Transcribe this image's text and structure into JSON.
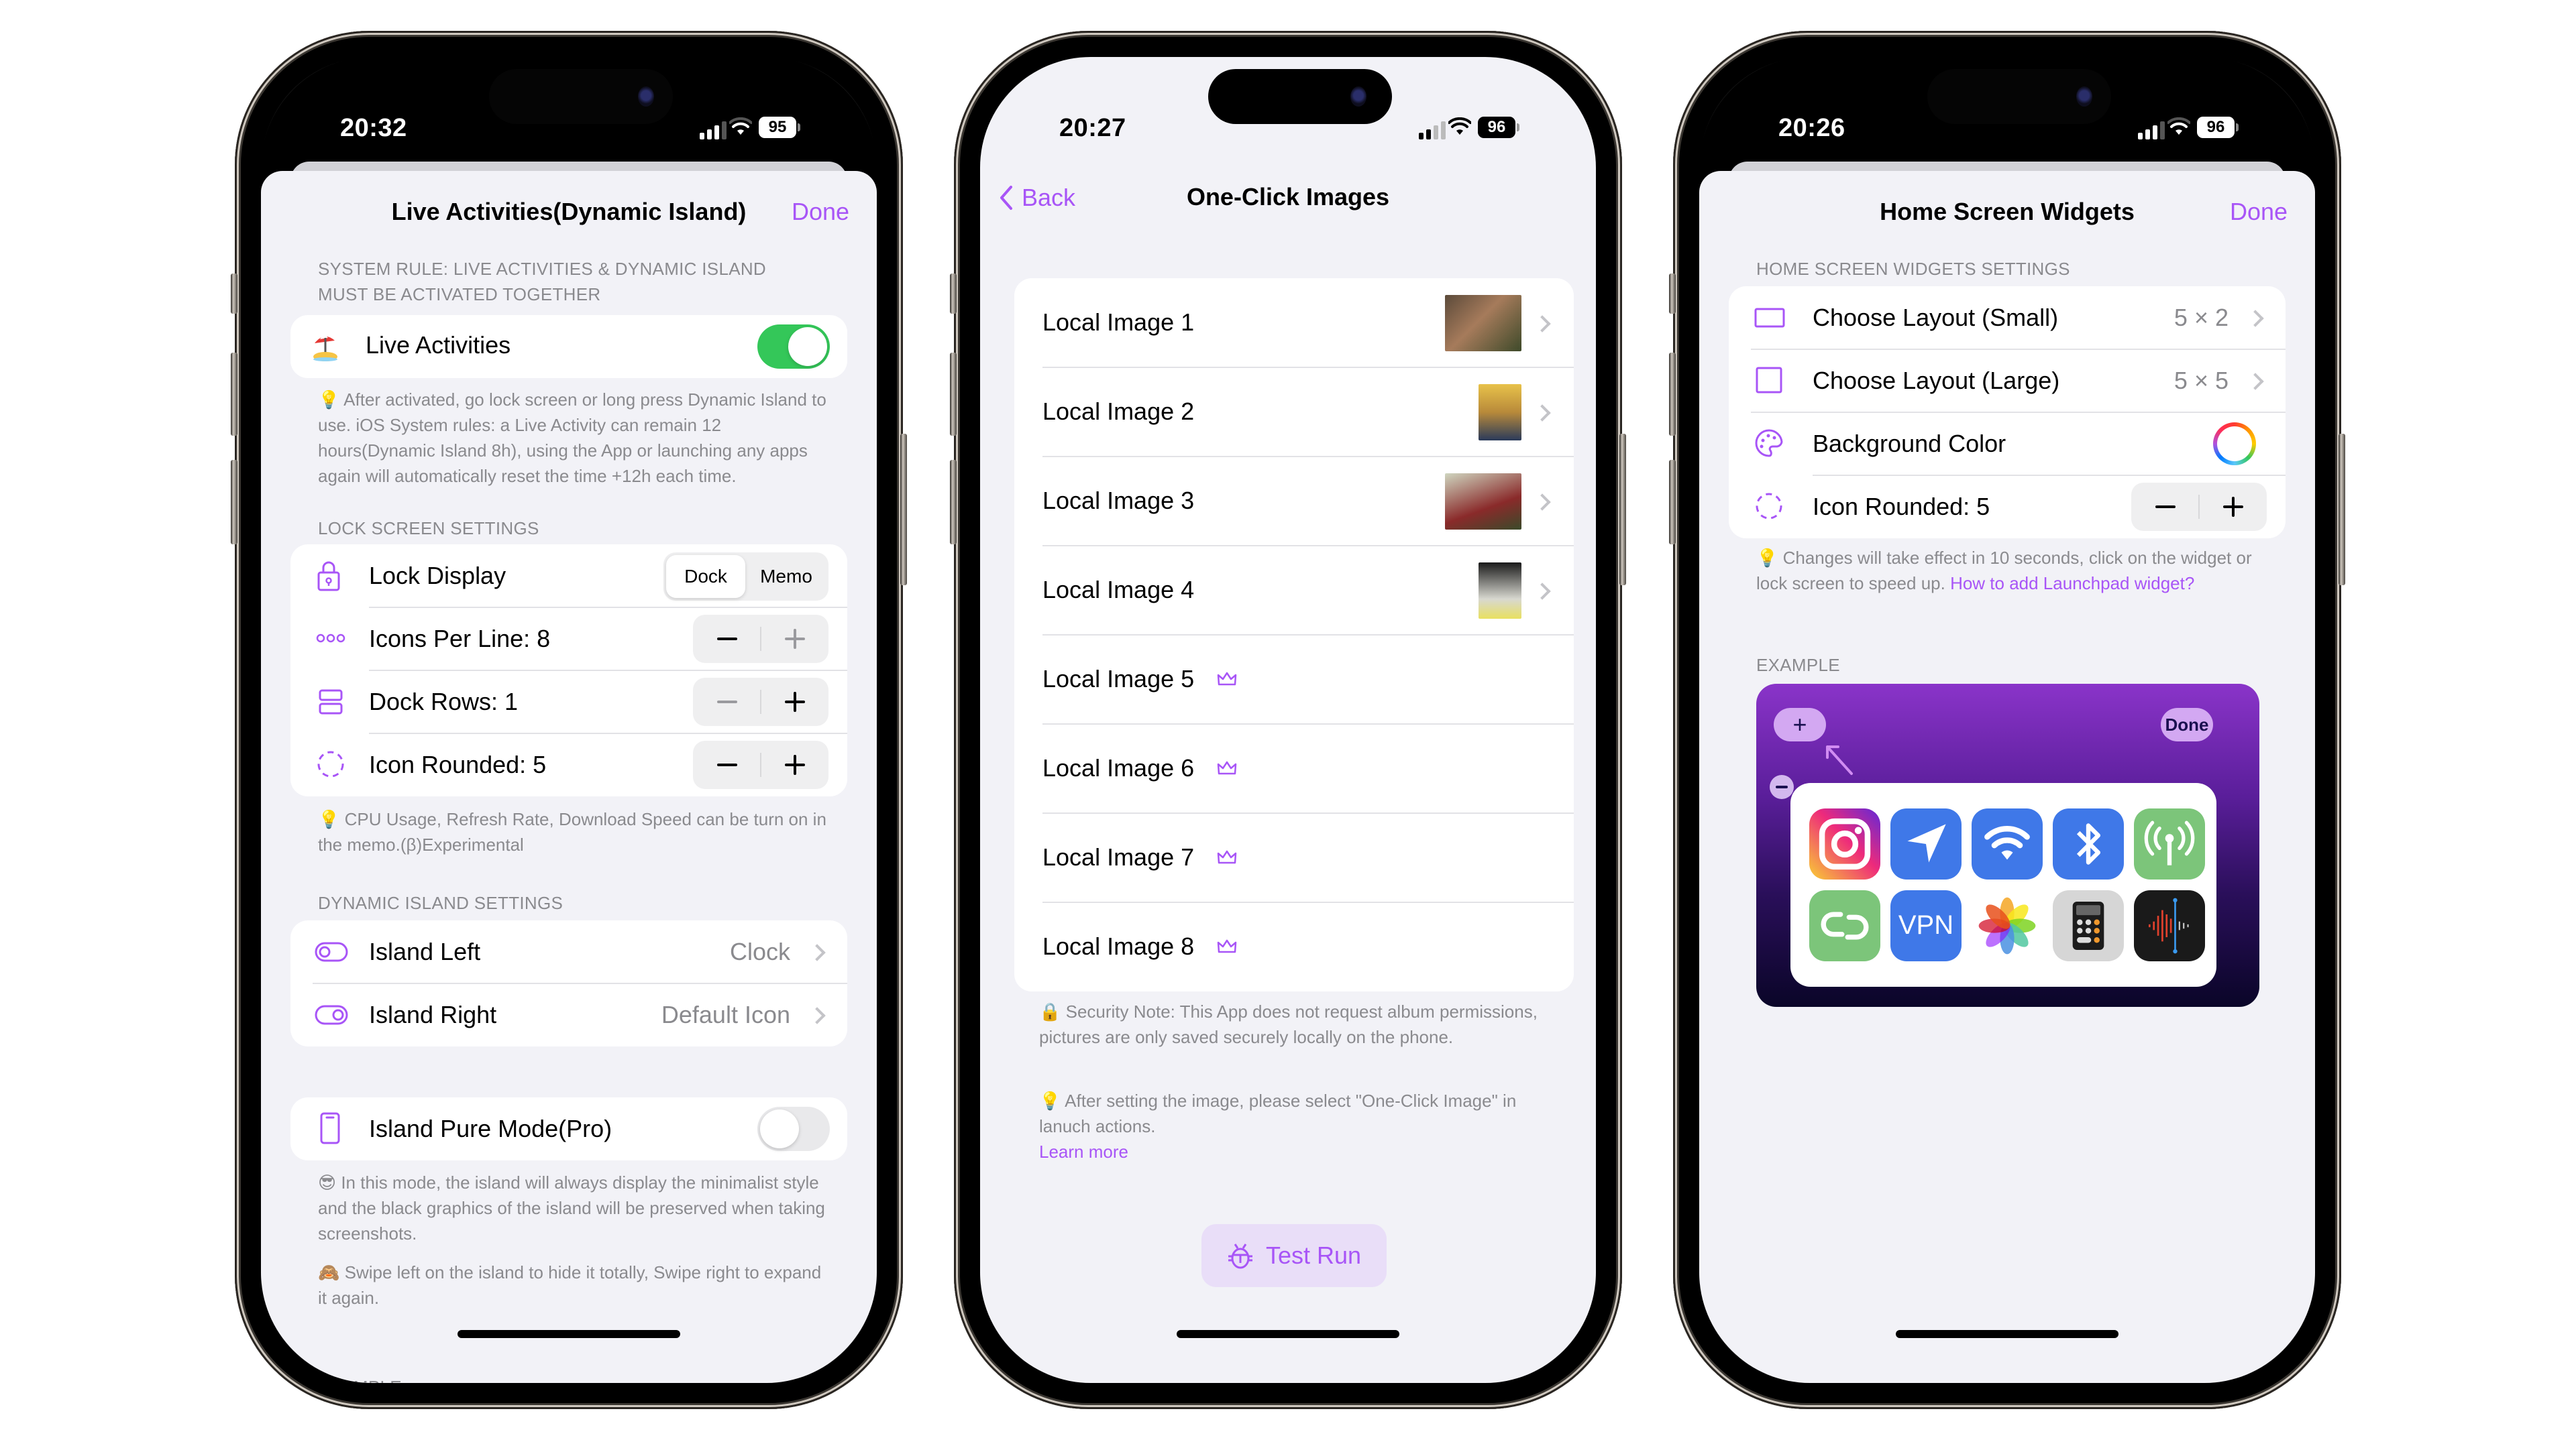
{
  "colors": {
    "accent": "#a855f7",
    "toggle_on": "#34c759",
    "toggle_off": "#e9e9eb",
    "secondary_text": "#8a8a8e",
    "background": "#f2f2f7"
  },
  "phones": [
    {
      "status": {
        "time": "20:32",
        "battery": "95",
        "signal_bars": 3
      },
      "nav": {
        "title": "Live Activities(Dynamic Island)",
        "done_label": "Done"
      },
      "sections": {
        "system_rule_header": "SYSTEM RULE: LIVE ACTIVITIES & DYNAMIC ISLAND MUST BE ACTIVATED TOGETHER",
        "live_activities": {
          "label": "Live Activities",
          "icon": "beach-umbrella-icon",
          "enabled": true
        },
        "live_note": "After activated, go lock screen or long press Dynamic Island to use. iOS System rules: a Live Activity can remain 12 hours(Dynamic Island 8h), using the App or launching any apps again will automatically reset the time +12h each time.",
        "lock_header": "LOCK SCREEN SETTINGS",
        "lock_display": {
          "label": "Lock Display",
          "options": [
            "Dock",
            "Memo"
          ],
          "selected": "Dock"
        },
        "icons_per_line": {
          "label": "Icons Per Line: 8",
          "value": 8,
          "plus_disabled": true
        },
        "dock_rows": {
          "label": "Dock Rows: 1",
          "value": 1,
          "minus_disabled": true
        },
        "icon_rounded": {
          "label": "Icon Rounded: 5",
          "value": 5
        },
        "lock_note": "CPU Usage, Refresh Rate, Download Speed can be turn on in the memo.(β)Experimental",
        "island_header": "DYNAMIC ISLAND SETTINGS",
        "island_left": {
          "label": "Island Left",
          "value": "Clock"
        },
        "island_right": {
          "label": "Island Right",
          "value": "Default Icon"
        },
        "pure_mode": {
          "label": "Island Pure Mode(Pro)",
          "enabled": false
        },
        "pure_note_1": "In this mode, the island will always display the minimalist style and the black graphics of the island will be preserved when taking screenshots.",
        "pure_note_2": "Swipe left on the island to hide it totally, Swipe right to expand it again.",
        "example_header": "EXAMPLE"
      }
    },
    {
      "status": {
        "time": "20:27",
        "battery": "96",
        "signal_bars": 2
      },
      "nav": {
        "back_label": "Back",
        "title": "One-Click Images"
      },
      "images": [
        {
          "label": "Local Image 1",
          "has_image": true,
          "pro": false
        },
        {
          "label": "Local Image 2",
          "has_image": true,
          "pro": false
        },
        {
          "label": "Local Image 3",
          "has_image": true,
          "pro": false
        },
        {
          "label": "Local Image 4",
          "has_image": true,
          "pro": false
        },
        {
          "label": "Local Image 5",
          "has_image": false,
          "pro": true
        },
        {
          "label": "Local Image 6",
          "has_image": false,
          "pro": true
        },
        {
          "label": "Local Image 7",
          "has_image": false,
          "pro": true
        },
        {
          "label": "Local Image 8",
          "has_image": false,
          "pro": true
        }
      ],
      "security_note": "Security Note: This App does not request album permissions, pictures are only saved securely locally on the phone.",
      "select_note": "After setting the image, please select \"One-Click Image\" in lanuch actions.",
      "learn_more": "Learn more",
      "test_run_label": "Test Run"
    },
    {
      "status": {
        "time": "20:26",
        "battery": "96",
        "signal_bars": 3
      },
      "nav": {
        "title": "Home Screen Widgets",
        "done_label": "Done"
      },
      "settings_header": "HOME SCREEN WIDGETS SETTINGS",
      "rows": {
        "layout_small": {
          "label": "Choose Layout (Small)",
          "value": "5 × 2"
        },
        "layout_large": {
          "label": "Choose Layout (Large)",
          "value": "5 × 5"
        },
        "background_color": {
          "label": "Background Color"
        },
        "icon_rounded": {
          "label": "Icon Rounded: 5",
          "value": 5
        }
      },
      "note_text": "Changes will take effect in 10 seconds, click on the widget or lock screen to speed up. ",
      "note_link": "How to add Launchpad widget?",
      "example_header": "EXAMPLE",
      "example": {
        "add_label": "+",
        "done_label": "Done",
        "apps": [
          "instagram",
          "location",
          "wifi",
          "bluetooth",
          "cellular-antenna",
          "link",
          "vpn",
          "photos",
          "calculator",
          "voice-memos"
        ],
        "vpn_label": "VPN"
      }
    }
  ]
}
